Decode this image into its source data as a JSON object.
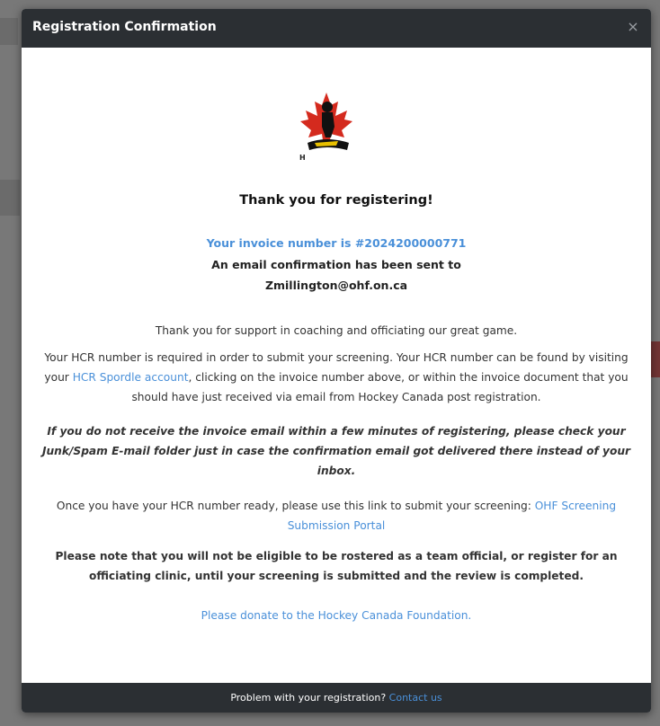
{
  "modal": {
    "title": "Registration Confirmation",
    "close_label": "×"
  },
  "logo": {
    "letter": "H"
  },
  "body": {
    "heading": "Thank you for registering!",
    "invoice_text": "Your invoice number is #2024200000771",
    "email_sent_text": "An email confirmation has been sent to",
    "email_address": "Zmillington@ohf.on.ca",
    "support_text": "Thank you for support in coaching and officiating our great game.",
    "hcr_text_1": "Your HCR number is required in order to submit your screening. Your HCR number can be found by visiting your ",
    "hcr_link": "HCR Spordle account",
    "hcr_text_2": ", clicking on the invoice number above, or within the invoice document that you should have just received via email from Hockey Canada post registration.",
    "spam_notice": "If you do not receive the invoice email within a few minutes of registering, please check your Junk/Spam E-mail folder just in case the confirmation email got delivered there instead of your inbox.",
    "screening_text": "Once you have your HCR number ready, please use this link to submit your screening: ",
    "screening_link": "OHF Screening Submission Portal",
    "eligibility_note": "Please note that you will not be eligible to be rostered as a team official, or register for an officiating clinic, until your screening is submitted and the review is completed.",
    "donate_link": "Please donate to the Hockey Canada Foundation."
  },
  "footer": {
    "problem_text": "Problem with your registration? ",
    "contact_link": "Contact us"
  },
  "colors": {
    "header_bg": "#2b2f33",
    "link": "#4a90d9",
    "leaf_red": "#d42a1e"
  }
}
